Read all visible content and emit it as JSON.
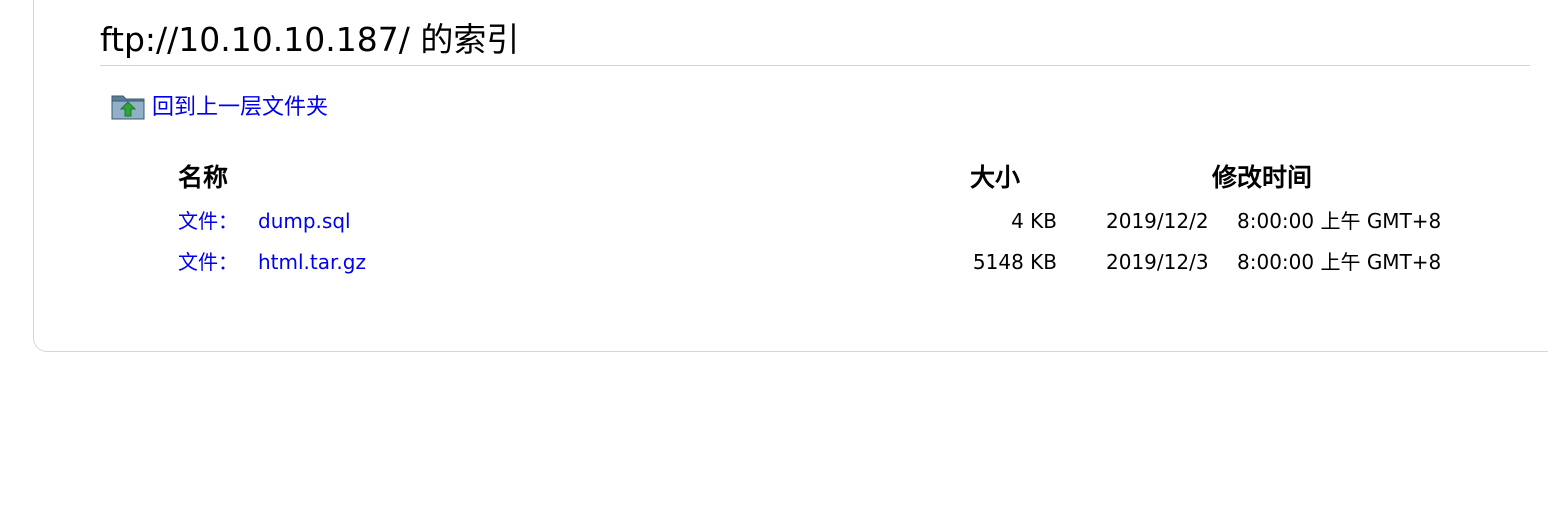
{
  "page": {
    "title": "ftp://10.10.10.187/ 的索引"
  },
  "up_link": {
    "label": "回到上一层文件夹",
    "icon": "folder-up-icon"
  },
  "table": {
    "headers": {
      "name": "名称",
      "size": "大小",
      "modified": "修改时间"
    },
    "rows": [
      {
        "prefix": "文件：",
        "name": "dump.sql",
        "size": "4 KB",
        "date": "2019/12/2",
        "time": "8:00:00 上午 GMT+8"
      },
      {
        "prefix": "文件：",
        "name": "html.tar.gz",
        "size": "5148 KB",
        "date": "2019/12/3",
        "time": "8:00:00 上午 GMT+8"
      }
    ]
  },
  "colors": {
    "link": "#0000ee",
    "rule": "#d4d4d8",
    "panel_border": "#d7d7db"
  }
}
